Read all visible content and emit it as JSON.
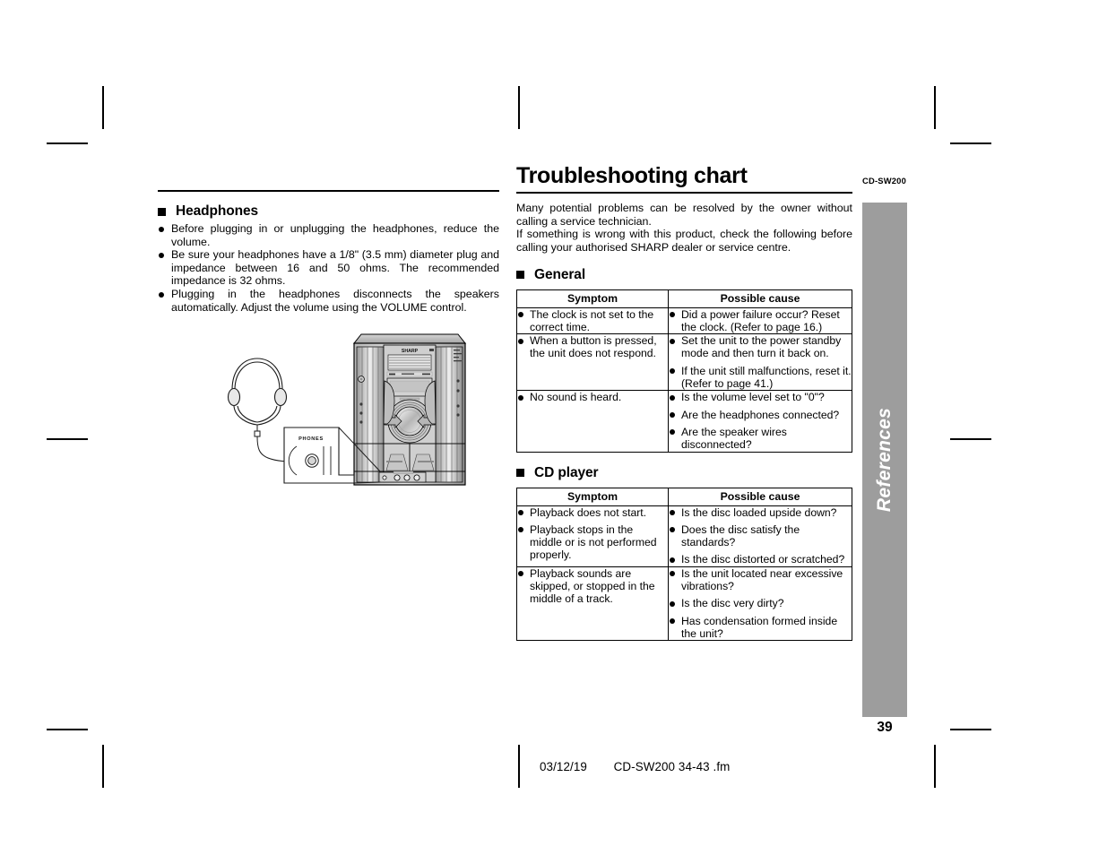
{
  "document": {
    "model_code": "CD-SW200",
    "page_number": "39",
    "side_tab_label": "References",
    "footer": {
      "date": "03/12/19",
      "filename": "CD-SW200 34-43 .fm"
    },
    "colors": {
      "side_tab": "#9d9d9d",
      "text": "#000000",
      "background": "#ffffff"
    }
  },
  "left_column": {
    "section": {
      "heading": "Headphones",
      "bullets": [
        "Before plugging in or unplugging the headphones, reduce the volume.",
        "Be sure your headphones have a 1/8\" (3.5 mm) diameter plug and impedance between 16 and 50 ohms. The recommended impedance is 32 ohms.",
        "Plugging in the headphones disconnects the speakers automatically. Adjust the volume using the VOLUME control."
      ]
    },
    "illustration": {
      "name": "headphones-connection-diagram",
      "callout_label": "PHONES",
      "brand_label": "SHARP"
    }
  },
  "right_column": {
    "title": "Troubleshooting chart",
    "intro": [
      "Many potential problems can be resolved by the owner without calling a service technician.",
      "If something is wrong with this product, check the following before calling your authorised SHARP dealer or service centre."
    ],
    "tables": [
      {
        "heading": "General",
        "headers": [
          "Symptom",
          "Possible cause"
        ],
        "rows": [
          {
            "symptom": [
              "The clock is not set to the correct time."
            ],
            "cause": [
              "Did a power failure occur? Reset the clock. (Refer to page 16.)"
            ]
          },
          {
            "symptom": [
              "When a button is pressed, the unit does not respond."
            ],
            "cause": [
              "Set the unit to the power standby mode and then turn it back on.",
              "If the unit still malfunctions, reset it. (Refer to page 41.)"
            ]
          },
          {
            "symptom": [
              "No sound is heard."
            ],
            "cause": [
              "Is the volume level set to \"0\"?",
              "Are the headphones connected?",
              "Are the speaker wires disconnected?"
            ]
          }
        ]
      },
      {
        "heading": "CD player",
        "headers": [
          "Symptom",
          "Possible cause"
        ],
        "rows": [
          {
            "symptom": [
              "Playback does not start.",
              "Playback stops in the middle or is not performed properly."
            ],
            "cause": [
              "Is the disc loaded upside down?",
              "Does the disc satisfy the standards?",
              "Is the disc distorted or scratched?"
            ]
          },
          {
            "symptom": [
              "Playback sounds are skipped, or stopped in the middle of a track."
            ],
            "cause": [
              "Is the unit located near excessive vibrations?",
              "Is the disc very dirty?",
              "Has condensation formed inside the unit?"
            ]
          }
        ]
      }
    ]
  }
}
